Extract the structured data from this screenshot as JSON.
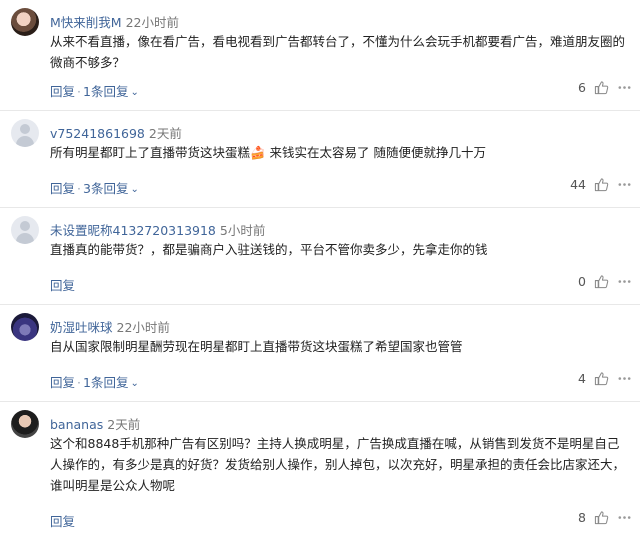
{
  "comments": [
    {
      "username": "M快来削我M",
      "time": "22小时前",
      "text": "从来不看直播，像在看广告，看电视看到广告都转台了，不懂为什么会玩手机都要看广告，难道朋友圈的微商不够多？",
      "reply_label": "回复",
      "replies_label": "1条回复",
      "likes": "6"
    },
    {
      "username": "v75241861698",
      "time": "2天前",
      "text": "所有明星都盯上了直播带货这块蛋糕🍰 来钱实在太容易了 随随便便就挣几十万",
      "reply_label": "回复",
      "replies_label": "3条回复",
      "likes": "44"
    },
    {
      "username": "未设置昵称4132720313918",
      "time": "5小时前",
      "text": "直播真的能带货？，都是骗商户入驻送钱的，平台不管你卖多少，先拿走你的钱",
      "reply_label": "回复",
      "likes": "0"
    },
    {
      "username": "奶湿吐咪球",
      "time": "22小时前",
      "text": "自从国家限制明星酬劳现在明星都盯上直播带货这块蛋糕了希望国家也管管",
      "reply_label": "回复",
      "replies_label": "1条回复",
      "likes": "4"
    },
    {
      "username": "bananas",
      "time": "2天前",
      "text": "这个和8848手机那种广告有区别吗？主持人换成明星，广告换成直播在喊，从销售到发货不是明星自己人操作的，有多少是真的好货？发货给别人操作，别人掉包，以次充好，明星承担的责任会比店家还大，谁叫明星是公众人物呢",
      "reply_label": "回复",
      "likes": "8"
    }
  ],
  "separator": "·",
  "icons": {
    "like": "thumbs-up-icon",
    "more": "more-dots-icon",
    "expand": "chevron-down-icon"
  },
  "colors": {
    "link": "#406599",
    "text": "#222222",
    "muted": "#777777",
    "divider": "#e8e8e8"
  }
}
